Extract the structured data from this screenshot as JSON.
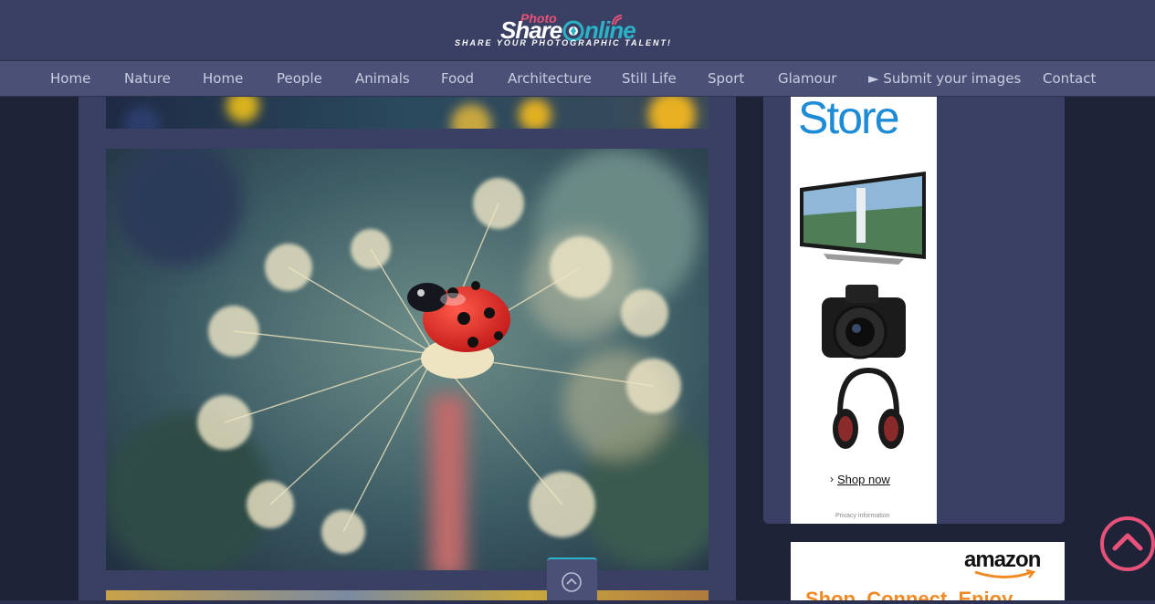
{
  "logo": {
    "photo": "Photo",
    "share": "Share",
    "online": "nline",
    "tagline": "SHARE YOUR PHOTOGRAPHIC TALENT!"
  },
  "nav": [
    {
      "label": "Home"
    },
    {
      "label": "Nature"
    },
    {
      "label": "Home"
    },
    {
      "label": "People"
    },
    {
      "label": "Animals"
    },
    {
      "label": "Food"
    },
    {
      "label": "Architecture"
    },
    {
      "label": "Still Life"
    },
    {
      "label": "Sport"
    },
    {
      "label": "Glamour"
    },
    {
      "label": "► Submit your images"
    },
    {
      "label": "Contact"
    }
  ],
  "ad_store": {
    "title": "Store",
    "cta": "Shop now",
    "privacy": "Privacy information"
  },
  "ad_amazon": {
    "logo": "amazon",
    "tagline": "Shop. Connect. Enjoy."
  },
  "colors": {
    "accent_teal": "#2ab3c6",
    "accent_pink": "#e8527a",
    "header_bg": "#3a4063",
    "nav_bg": "#4a5076"
  }
}
